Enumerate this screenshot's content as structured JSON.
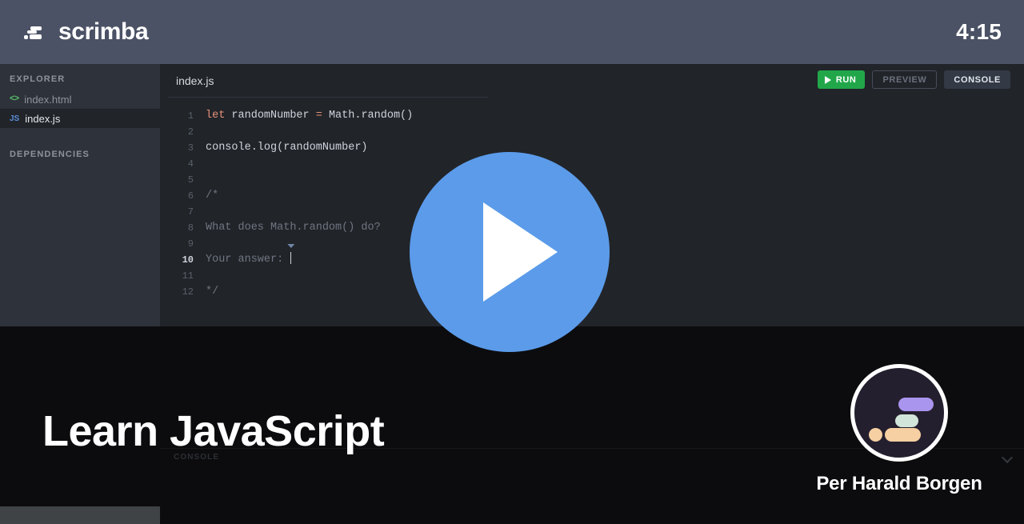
{
  "header": {
    "brand_name": "scrimba",
    "logo_icon": "scrimba-speedlines-icon",
    "timer": "4:15"
  },
  "sidebar": {
    "explorer_label": "EXPLORER",
    "dependencies_label": "DEPENDENCIES",
    "files": [
      {
        "name": "index.html",
        "icon": "html-brackets-icon",
        "icon_text": "<>",
        "active": false
      },
      {
        "name": "index.js",
        "icon": "js-file-icon",
        "icon_text": "JS",
        "active": true
      }
    ]
  },
  "editor": {
    "tab_label": "index.js",
    "toolbar": {
      "run_label": "RUN",
      "run_icon": "play-icon",
      "preview_label": "PREVIEW",
      "console_label": "CONSOLE"
    },
    "lines": [
      {
        "n": "1",
        "segments": [
          {
            "t": "let",
            "c": "kw"
          },
          {
            "t": " randomNumber ",
            "c": ""
          },
          {
            "t": "=",
            "c": "op"
          },
          {
            "t": " Math.random()",
            "c": ""
          }
        ]
      },
      {
        "n": "2",
        "segments": []
      },
      {
        "n": "3",
        "segments": [
          {
            "t": "console.log(randomNumber)",
            "c": ""
          }
        ]
      },
      {
        "n": "4",
        "segments": []
      },
      {
        "n": "5",
        "segments": []
      },
      {
        "n": "6",
        "segments": [
          {
            "t": "/*",
            "c": "cmt"
          }
        ]
      },
      {
        "n": "7",
        "segments": []
      },
      {
        "n": "8",
        "segments": [
          {
            "t": "What does Math.random() do?",
            "c": "cmt"
          }
        ]
      },
      {
        "n": "9",
        "segments": []
      },
      {
        "n": "10",
        "segments": [
          {
            "t": "Your answer: ",
            "c": "cmt"
          }
        ],
        "current": true,
        "caret": true
      },
      {
        "n": "11",
        "segments": []
      },
      {
        "n": "12",
        "segments": [
          {
            "t": "*/",
            "c": "cmt"
          }
        ]
      }
    ]
  },
  "console": {
    "label": "CONSOLE",
    "collapse_icon": "chevron-down-icon",
    "output": ""
  },
  "video_overlay": {
    "play_icon": "play-circle-icon",
    "title": "Learn JavaScript",
    "author_name": "Per Harald Borgen",
    "avatar_icon": "scrimba-avatar-icon"
  },
  "colors": {
    "header_bg": "#4b5265",
    "sidebar_bg": "#2e323a",
    "editor_bg": "#212429",
    "console_bg": "#0c0c0e",
    "run_green": "#21a74a",
    "play_blue": "#5b9bea",
    "keyword_orange": "#e8927c",
    "comment_gray": "#6f7681",
    "js_blue": "#5b8dd6",
    "html_green": "#58c06a"
  }
}
